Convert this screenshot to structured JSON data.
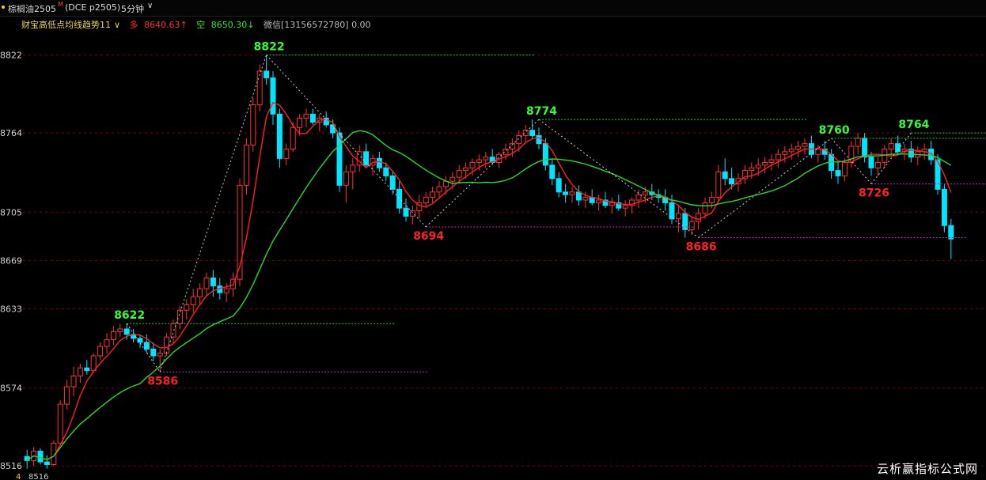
{
  "window": {
    "symbol": "棕榈油2505",
    "symbol_sup": "M",
    "code": "(DCE p2505)",
    "period": "5分钟",
    "period_chevron": "chevron-down-icon"
  },
  "indicator": {
    "name": "财宝高低点均线趋势11",
    "name_chevron": "chevron-down-icon",
    "up_label": "多",
    "up_value": "8640.63↑",
    "down_label": "空",
    "down_value": "8650.30↓",
    "contact": "微信[13156572780] 0.00"
  },
  "watermark": "云析赢指标公式网",
  "colors": {
    "up_candle": "#ff3030",
    "down_candle": "#00e5ff",
    "ma_fast": "#ff2020",
    "ma_slow": "#22dd22",
    "high_label": "#33ff33",
    "low_label": "#ff2020",
    "grid": "#7a0000"
  },
  "chart_data": {
    "type": "candlestick",
    "y_axis_ticks": [
      "8822",
      "8764",
      "8705",
      "8669",
      "8633",
      "8574",
      "8516"
    ],
    "bottom_left_labels": [
      "4",
      "8516"
    ],
    "price_range": [
      8512,
      8830
    ],
    "swing_points": [
      {
        "kind": "high",
        "label": "8622",
        "value": 8622,
        "bar": 15
      },
      {
        "kind": "low",
        "label": "8586",
        "value": 8586,
        "bar": 20
      },
      {
        "kind": "high",
        "label": "8822",
        "value": 8822,
        "bar": 36
      },
      {
        "kind": "low",
        "label": "8694",
        "value": 8694,
        "bar": 60
      },
      {
        "kind": "high",
        "label": "8774",
        "value": 8774,
        "bar": 77
      },
      {
        "kind": "low",
        "label": "8686",
        "value": 8686,
        "bar": 101
      },
      {
        "kind": "high",
        "label": "8760",
        "value": 8760,
        "bar": 121
      },
      {
        "kind": "low",
        "label": "8726",
        "value": 8726,
        "bar": 127
      },
      {
        "kind": "high",
        "label": "8764",
        "value": 8764,
        "bar": 133
      }
    ],
    "candles": [
      [
        8523,
        8528,
        8514,
        8520
      ],
      [
        8520,
        8530,
        8516,
        8527
      ],
      [
        8527,
        8529,
        8517,
        8519
      ],
      [
        8519,
        8524,
        8514,
        8517
      ],
      [
        8517,
        8535,
        8516,
        8533
      ],
      [
        8533,
        8565,
        8531,
        8562
      ],
      [
        8562,
        8580,
        8558,
        8575
      ],
      [
        8575,
        8590,
        8568,
        8583
      ],
      [
        8583,
        8592,
        8578,
        8589
      ],
      [
        8589,
        8595,
        8584,
        8587
      ],
      [
        8587,
        8600,
        8585,
        8598
      ],
      [
        8598,
        8608,
        8595,
        8605
      ],
      [
        8605,
        8615,
        8600,
        8610
      ],
      [
        8610,
        8620,
        8606,
        8616
      ],
      [
        8616,
        8622,
        8612,
        8618
      ],
      [
        8618,
        8622,
        8610,
        8614
      ],
      [
        8614,
        8618,
        8608,
        8611
      ],
      [
        8611,
        8614,
        8604,
        8608
      ],
      [
        8608,
        8614,
        8600,
        8603
      ],
      [
        8603,
        8608,
        8594,
        8598
      ],
      [
        8598,
        8603,
        8586,
        8600
      ],
      [
        8600,
        8615,
        8598,
        8612
      ],
      [
        8612,
        8625,
        8608,
        8622
      ],
      [
        8622,
        8635,
        8618,
        8632
      ],
      [
        8632,
        8640,
        8625,
        8636
      ],
      [
        8636,
        8648,
        8630,
        8642
      ],
      [
        8642,
        8652,
        8636,
        8648
      ],
      [
        8648,
        8660,
        8642,
        8656
      ],
      [
        8656,
        8662,
        8642,
        8650
      ],
      [
        8650,
        8656,
        8640,
        8645
      ],
      [
        8645,
        8652,
        8638,
        8648
      ],
      [
        8648,
        8660,
        8642,
        8655
      ],
      [
        8655,
        8730,
        8650,
        8725
      ],
      [
        8725,
        8760,
        8718,
        8755
      ],
      [
        8755,
        8790,
        8750,
        8785
      ],
      [
        8785,
        8815,
        8780,
        8810
      ],
      [
        8810,
        8822,
        8800,
        8805
      ],
      [
        8805,
        8810,
        8770,
        8778
      ],
      [
        8778,
        8782,
        8738,
        8745
      ],
      [
        8745,
        8756,
        8740,
        8752
      ],
      [
        8752,
        8772,
        8750,
        8768
      ],
      [
        8768,
        8778,
        8762,
        8775
      ],
      [
        8775,
        8782,
        8768,
        8778
      ],
      [
        8778,
        8782,
        8770,
        8772
      ],
      [
        8772,
        8778,
        8765,
        8775
      ],
      [
        8775,
        8780,
        8768,
        8770
      ],
      [
        8770,
        8774,
        8760,
        8764
      ],
      [
        8764,
        8768,
        8720,
        8725
      ],
      [
        8725,
        8740,
        8712,
        8735
      ],
      [
        8735,
        8745,
        8722,
        8740
      ],
      [
        8740,
        8755,
        8735,
        8750
      ],
      [
        8750,
        8756,
        8738,
        8740
      ],
      [
        8740,
        8748,
        8732,
        8745
      ],
      [
        8745,
        8750,
        8735,
        8738
      ],
      [
        8738,
        8742,
        8728,
        8732
      ],
      [
        8732,
        8736,
        8718,
        8722
      ],
      [
        8722,
        8728,
        8704,
        8708
      ],
      [
        8708,
        8715,
        8698,
        8702
      ],
      [
        8702,
        8710,
        8696,
        8706
      ],
      [
        8706,
        8718,
        8700,
        8712
      ],
      [
        8712,
        8720,
        8708,
        8716
      ],
      [
        8716,
        8724,
        8712,
        8720
      ],
      [
        8720,
        8728,
        8716,
        8724
      ],
      [
        8724,
        8732,
        8718,
        8728
      ],
      [
        8728,
        8735,
        8722,
        8731
      ],
      [
        8731,
        8740,
        8726,
        8736
      ],
      [
        8736,
        8742,
        8730,
        8738
      ],
      [
        8738,
        8745,
        8732,
        8742
      ],
      [
        8742,
        8748,
        8736,
        8744
      ],
      [
        8744,
        8750,
        8738,
        8746
      ],
      [
        8746,
        8752,
        8740,
        8742
      ],
      [
        8742,
        8750,
        8738,
        8748
      ],
      [
        8748,
        8756,
        8744,
        8752
      ],
      [
        8752,
        8760,
        8746,
        8756
      ],
      [
        8756,
        8766,
        8750,
        8762
      ],
      [
        8762,
        8770,
        8756,
        8766
      ],
      [
        8766,
        8774,
        8760,
        8762
      ],
      [
        8762,
        8768,
        8752,
        8756
      ],
      [
        8756,
        8760,
        8736,
        8740
      ],
      [
        8740,
        8745,
        8725,
        8730
      ],
      [
        8730,
        8735,
        8716,
        8720
      ],
      [
        8720,
        8726,
        8712,
        8718
      ],
      [
        8718,
        8724,
        8712,
        8720
      ],
      [
        8720,
        8725,
        8710,
        8714
      ],
      [
        8714,
        8720,
        8708,
        8716
      ],
      [
        8716,
        8722,
        8710,
        8712
      ],
      [
        8712,
        8718,
        8706,
        8714
      ],
      [
        8714,
        8720,
        8708,
        8710
      ],
      [
        8710,
        8716,
        8704,
        8712
      ],
      [
        8712,
        8718,
        8706,
        8708
      ],
      [
        8708,
        8714,
        8702,
        8710
      ],
      [
        8710,
        8716,
        8704,
        8714
      ],
      [
        8714,
        8722,
        8708,
        8718
      ],
      [
        8718,
        8724,
        8712,
        8720
      ],
      [
        8720,
        8726,
        8714,
        8718
      ],
      [
        8718,
        8722,
        8712,
        8716
      ],
      [
        8716,
        8722,
        8706,
        8712
      ],
      [
        8712,
        8718,
        8696,
        8700
      ],
      [
        8700,
        8710,
        8690,
        8704
      ],
      [
        8704,
        8708,
        8686,
        8692
      ],
      [
        8692,
        8702,
        8688,
        8698
      ],
      [
        8698,
        8708,
        8692,
        8704
      ],
      [
        8704,
        8716,
        8700,
        8712
      ],
      [
        8712,
        8720,
        8708,
        8716
      ],
      [
        8716,
        8740,
        8712,
        8735
      ],
      [
        8735,
        8745,
        8725,
        8730
      ],
      [
        8730,
        8738,
        8722,
        8726
      ],
      [
        8726,
        8734,
        8720,
        8730
      ],
      [
        8730,
        8740,
        8726,
        8736
      ],
      [
        8736,
        8742,
        8730,
        8738
      ],
      [
        8738,
        8745,
        8732,
        8740
      ],
      [
        8740,
        8746,
        8734,
        8742
      ],
      [
        8742,
        8748,
        8736,
        8744
      ],
      [
        8744,
        8752,
        8738,
        8748
      ],
      [
        8748,
        8754,
        8742,
        8750
      ],
      [
        8750,
        8756,
        8744,
        8752
      ],
      [
        8752,
        8758,
        8746,
        8754
      ],
      [
        8754,
        8760,
        8748,
        8756
      ],
      [
        8756,
        8762,
        8745,
        8748
      ],
      [
        8748,
        8755,
        8742,
        8752
      ],
      [
        8752,
        8758,
        8744,
        8748
      ],
      [
        8748,
        8752,
        8730,
        8736
      ],
      [
        8736,
        8742,
        8726,
        8732
      ],
      [
        8732,
        8745,
        8728,
        8742
      ],
      [
        8742,
        8758,
        8738,
        8754
      ],
      [
        8754,
        8764,
        8748,
        8760
      ],
      [
        8760,
        8764,
        8742,
        8746
      ],
      [
        8746,
        8750,
        8732,
        8738
      ],
      [
        8738,
        8746,
        8732,
        8742
      ],
      [
        8742,
        8755,
        8738,
        8752
      ],
      [
        8752,
        8760,
        8746,
        8756
      ],
      [
        8756,
        8762,
        8748,
        8750
      ],
      [
        8750,
        8756,
        8744,
        8752
      ],
      [
        8752,
        8758,
        8742,
        8746
      ],
      [
        8746,
        8754,
        8740,
        8750
      ],
      [
        8750,
        8756,
        8744,
        8752
      ],
      [
        8752,
        8758,
        8740,
        8744
      ],
      [
        8744,
        8748,
        8718,
        8722
      ],
      [
        8722,
        8726,
        8690,
        8695
      ],
      [
        8695,
        8700,
        8670,
        8685
      ]
    ]
  }
}
